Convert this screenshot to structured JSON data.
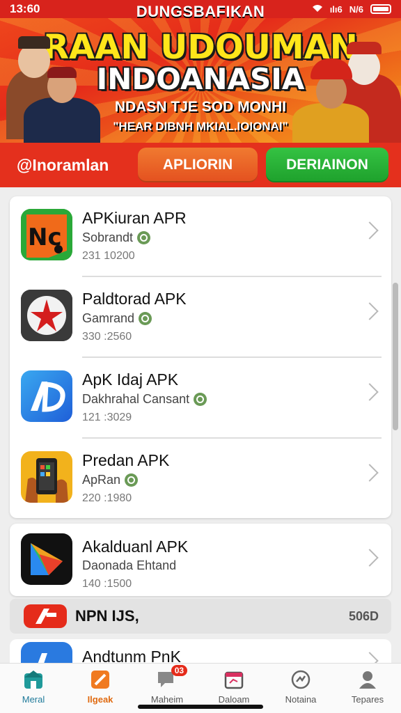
{
  "status_bar": {
    "time": "13:60",
    "network": "ılı6",
    "signal_text": "N/6"
  },
  "banner": {
    "top_text": "DUNGSBAFIKAN",
    "title_line1": "RAAN UDOUMAN",
    "title_line2": "INDOANASIA",
    "subtitle": "NDASN TJE SOD MONHI",
    "tagline": "\"HEAR DIBNH MKIAL.IOIONAI\""
  },
  "tabs": {
    "brand": "@Inoramlan",
    "orange_button": "APLIORIN",
    "green_button": "DERIAINON"
  },
  "apps": [
    {
      "name": "APKiuran APR",
      "developer": "Sobrandt",
      "count": "231 10200",
      "icon": "nc-logo-icon"
    },
    {
      "name": "Paldtorad APK",
      "developer": "Gamrand",
      "count": "330 :2560",
      "icon": "red-star-icon"
    },
    {
      "name": "ApK Idaj APK",
      "developer": "Dakhrahal Cansant",
      "count": "121 :3029",
      "icon": "ab-logo-icon"
    },
    {
      "name": "Predan APK",
      "developer": "ApRan",
      "count": "220 :1980",
      "icon": "phone-hand-icon"
    },
    {
      "name": "Akalduanl APK",
      "developer": "Daonada Ehtand",
      "count": "140 :1500",
      "icon": "triangle-logo-icon"
    }
  ],
  "section": {
    "title": "NPN IJS,",
    "right_value": "506D"
  },
  "partial_app": {
    "name": "Andtunm PnK"
  },
  "bottom_nav": [
    {
      "label": "Meral",
      "icon": "home-icon"
    },
    {
      "label": "Ilgeak",
      "icon": "tag-icon"
    },
    {
      "label": "Maheim",
      "icon": "chat-icon",
      "badge": "03"
    },
    {
      "label": "Daloam",
      "icon": "calendar-icon"
    },
    {
      "label": "Notaina",
      "icon": "activity-icon"
    },
    {
      "label": "Tepares",
      "icon": "profile-icon"
    }
  ],
  "colors": {
    "brand_red": "#e4301d",
    "accent_orange": "#f07a30",
    "accent_green": "#1ea12c"
  }
}
